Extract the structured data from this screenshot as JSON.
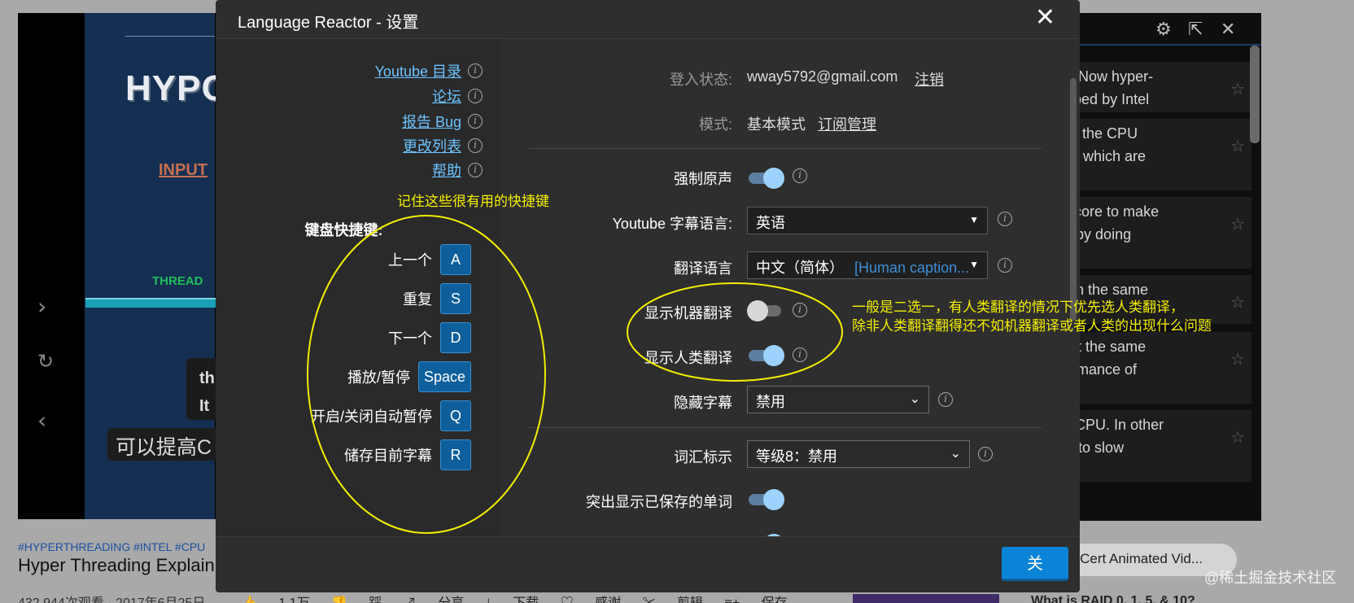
{
  "modal": {
    "title": "Language Reactor - 设置",
    "close_label": "关"
  },
  "sidebar": {
    "links": [
      "Youtube 目录",
      "论坛",
      "报告 Bug",
      "更改列表",
      "帮助"
    ],
    "shortcuts_title": "键盘快捷键:",
    "shortcuts": [
      {
        "label": "上一个",
        "key": "A"
      },
      {
        "label": "重复",
        "key": "S"
      },
      {
        "label": "下一个",
        "key": "D"
      },
      {
        "label": "播放/暂停",
        "key": "Space"
      },
      {
        "label": "开启/关闭自动暂停",
        "key": "Q"
      },
      {
        "label": "储存目前字幕",
        "key": "R"
      }
    ]
  },
  "settings": {
    "login_label": "登入状态:",
    "login_email": "wway5792@gmail.com",
    "logout_link": "注销",
    "mode_label": "模式:",
    "mode_value": "基本模式",
    "subscription_link": "订阅管理",
    "force_original_audio": "强制原声",
    "subtitle_lang_label": "Youtube 字幕语言:",
    "subtitle_lang_value": "英语",
    "translation_lang_label": "翻译语言",
    "translation_lang_value": "中文（简体）",
    "translation_lang_extra": "[Human caption...",
    "show_machine_label": "显示机器翻译",
    "show_human_label": "显示人类翻译",
    "hide_subs_label": "隐藏字幕",
    "hide_subs_value": "禁用",
    "vocab_label": "词汇标示",
    "vocab_value": "等级8：禁用",
    "highlight_saved_label": "突出显示已保存的单词",
    "toggles": {
      "force_original_audio": true,
      "show_machine_translation": false,
      "show_human_translation": true,
      "highlight_saved_words": true
    }
  },
  "annotations": {
    "shortcuts_note": "记住这些很有用的快捷键",
    "translation_note_line1": "一般是二选一，有人类翻译的情况下优先选人类翻译，",
    "translation_note_line2": "除非人类翻译翻得还不如机器翻译或者人类的出现什么问题",
    "color": "#f2ee00"
  },
  "background": {
    "video_text_hypo": "HYPO",
    "video_text_input": "INPUT",
    "video_text_thread": "THREAD",
    "caption_en_1": "th",
    "caption_en_2": "It",
    "caption_zh": "可以提高C",
    "transcript": [
      {
        "line1": "ding? Now  hyper-",
        "line2": "eveloped by Intel"
      },
      {
        "line1": "nce of the CPU",
        "line2": "reads, which are"
      },
      {
        "line1": "each core to make",
        "line2": ". And by doing"
      },
      {
        "line1": "asks in the same",
        "line2": ""
      },
      {
        "line1": "ions at the same",
        "line2": "performance of"
      },
      {
        "line1": "aded CPU. In other",
        "line2": "going to slow"
      }
    ],
    "hashtags": "#HYPERTHREADING #INTEL #CPU",
    "video_title": "Hyper Threading Explain",
    "views": "432,944次观看 · 2017年6月25日",
    "actions": "👍 1.1万 👎 踩 ↗ 分享 ⤓ 下载 ♡ 感谢 ✂ 剪辑 ≡+ 保存",
    "chip_text": "erCert Animated Vid...",
    "next_title": "What is RAID 0, 1, 5, & 10?",
    "watermark": "@稀土掘金技术社区"
  },
  "icons": {
    "info": "info-icon",
    "close": "close-icon",
    "settings": "gear-icon",
    "popout": "popout-icon",
    "star": "star-icon"
  }
}
